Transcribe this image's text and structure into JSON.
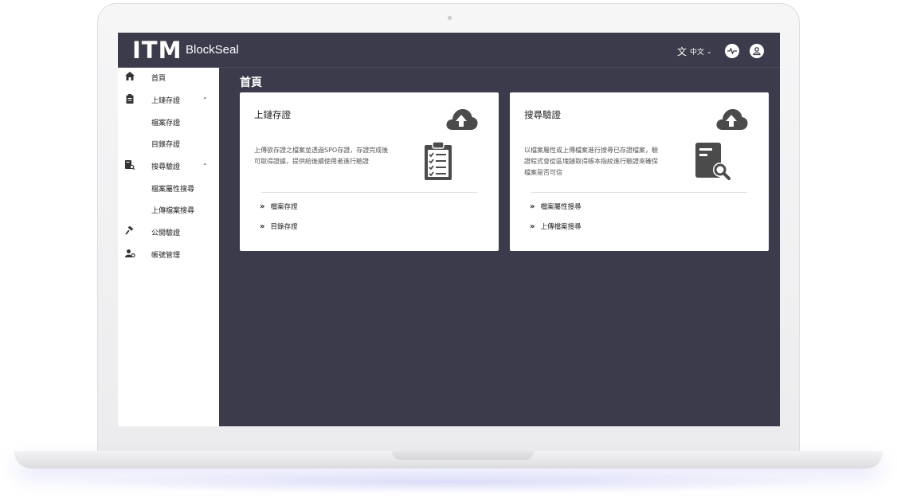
{
  "header": {
    "logo_mark": "ITM",
    "logo_text": "BlockSeal",
    "language_label": "中文",
    "language_icon": "translate-icon",
    "activity_icon": "pulse-icon",
    "user_icon": "user-icon"
  },
  "sidebar": {
    "items": [
      {
        "label": "首頁",
        "icon": "home-icon"
      },
      {
        "label": "上鏈存證",
        "icon": "clipboard-icon",
        "expanded": true
      },
      {
        "label": "檔案存證"
      },
      {
        "label": "目錄存證"
      },
      {
        "label": "搜尋驗證",
        "icon": "document-search-icon",
        "expanded": true
      },
      {
        "label": "檔案屬性搜尋"
      },
      {
        "label": "上傳檔案搜尋"
      },
      {
        "label": "公開驗證",
        "icon": "gavel-icon"
      },
      {
        "label": "帳號管理",
        "icon": "user-manage-icon"
      }
    ]
  },
  "main": {
    "title": "首頁",
    "cards": [
      {
        "title": "上鏈存證",
        "description": "上傳欲存證之檔案並透過SPO存證，存證完成後可取得證據，提供給後續使用者進行驗證",
        "links": [
          "檔案存證",
          "目錄存證"
        ],
        "icon": "clipboard-checklist-icon"
      },
      {
        "title": "搜尋驗證",
        "description": "以檔案屬性或上傳檔案進行搜尋已存證檔案，驗證程式會從區塊鏈取得帳本指紋進行驗證來確保檔案是否可信",
        "links": [
          "檔案屬性搜尋",
          "上傳檔案搜尋"
        ],
        "icon": "document-search-icon"
      }
    ]
  },
  "colors": {
    "background": "#3b3b4b",
    "surface": "#ffffff",
    "icon": "#4b4b4b"
  }
}
